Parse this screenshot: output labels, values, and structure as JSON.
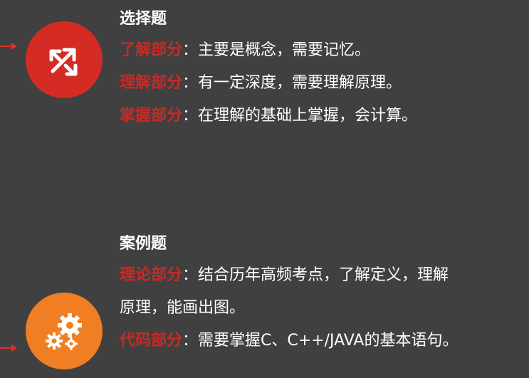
{
  "section1": {
    "title": "选择题",
    "items": [
      {
        "key": "了解部分",
        "colon": "：",
        "text": "主要是概念，需要记忆。"
      },
      {
        "key": "理解部分",
        "colon": "：",
        "text": "有一定深度，需要理解原理。"
      },
      {
        "key": "掌握部分",
        "colon": "：",
        "text": "在理解的基础上掌握，会计算。"
      }
    ],
    "icon": "arrows-icon",
    "color": "#d42c25"
  },
  "section2": {
    "title": "案例题",
    "items": [
      {
        "key": "理论部分",
        "colon": "：",
        "text": "结合历年高频考点，了解定义，理解",
        "cont": "原理，能画出图。"
      },
      {
        "key": "代码部分",
        "colon": "：",
        "text": "需要掌握C、C++/JAVA的基本语句。"
      }
    ],
    "icon": "gears-icon",
    "color": "#ef7f22"
  },
  "accent": "#c82a24"
}
